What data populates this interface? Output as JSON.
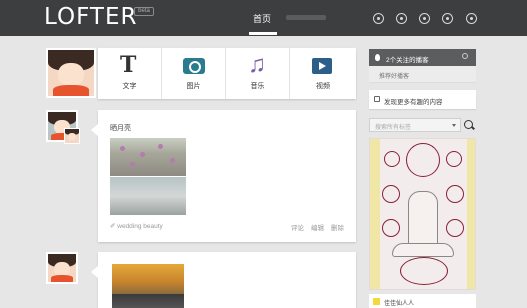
{
  "header": {
    "logo": "LOFTER",
    "beta": "beta",
    "nav": [
      {
        "label": "首页",
        "active": true
      }
    ],
    "icons": [
      "settings-icon",
      "message-icon",
      "target-icon",
      "user-icon",
      "power-icon"
    ]
  },
  "publish": {
    "items": [
      {
        "label": "文字",
        "icon": "text-icon",
        "icon_text": "T"
      },
      {
        "label": "图片",
        "icon": "camera-icon"
      },
      {
        "label": "音乐",
        "icon": "music-icon",
        "icon_text": "♫"
      },
      {
        "label": "视频",
        "icon": "video-icon"
      }
    ]
  },
  "posts": [
    {
      "title": "晒月亮",
      "tags": "✐ wedding beauty",
      "actions": [
        "评论",
        "编辑",
        "删除"
      ]
    },
    {
      "title": "",
      "tags": "",
      "actions": []
    }
  ],
  "sidebar": {
    "following": "2个关注的播客",
    "recommend": "推荐好播客",
    "discover": "发现更多有趣的内容",
    "search_placeholder": "搜索所有标签",
    "user_name": "佳佳仙人人"
  },
  "colors": {
    "header_bg": "#3c3e40",
    "page_bg": "#e6e6e6",
    "camera_accent": "#2a7b8e",
    "music_accent": "#7b5ea8",
    "video_accent": "#2c5e8a"
  }
}
